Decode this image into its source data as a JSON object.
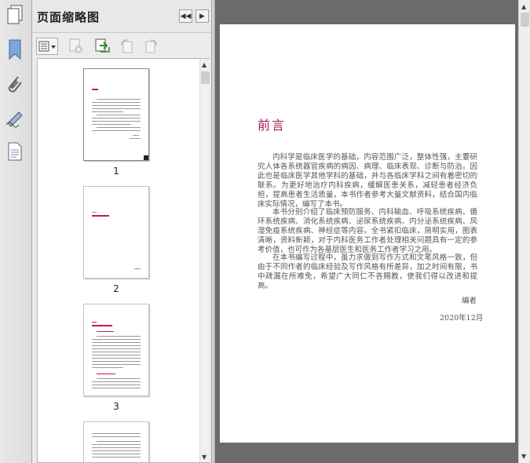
{
  "panel": {
    "title": "页面缩略图",
    "thumbnails": [
      {
        "label": "1"
      },
      {
        "label": "2"
      },
      {
        "label": "3"
      }
    ]
  },
  "document": {
    "heading": "前言",
    "paragraphs": [
      "内科学是临床医学的基础，内容范围广泛，整体性强，主要研究人体各系统器官疾病的病因、病理、临床表现、诊断与防治。因此也是临床医学其他学科的基础，并与各临床学科之间有着密切的联系。为更好地治疗内科疾病，缓解医患关系，减轻患者经济负担，提高患者生活质量，本书作者参考大量文献资料，结合国内临床实际情况，编写了本书。",
      "本书分别介绍了临床预防服务、内科输血、呼吸系统疾病、循环系统疾病、消化系统疾病、泌尿系统疾病、内分泌系统疾病、风湿免疫系统疾病、神经症等内容。全书紧扣临床，简明实用，图表清晰，资料新颖，对于内科医务工作者处理相关问题具有一定的参考价值，也可作为各基层医生和医务工作者学习之用。",
      "在本书编写过程中，虽力求做到写作方式和文笔风格一致，但由于不同作者的临床经验及写作风格有所差异，加之时间有限，书中疏漏在所难免，希望广大同仁不吝赐教，使我们得以改进和提高。"
    ],
    "signature": "编者",
    "date": "2020年12月"
  }
}
